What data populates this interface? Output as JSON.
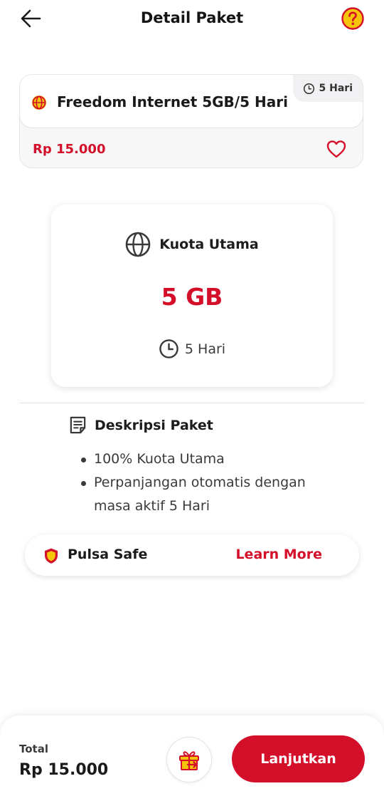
{
  "header": {
    "title": "Detail Paket",
    "back_icon": "arrow-left-icon",
    "help_icon": "question-circle-icon"
  },
  "package": {
    "name": "Freedom Internet 5GB/5 Hari",
    "duration_tag": "5 Hari",
    "price": "Rp 15.000",
    "icon": "globe-icon",
    "favorite_icon": "heart-icon"
  },
  "quota": {
    "label": "Kuota Utama",
    "amount": "5 GB",
    "duration": "5 Hari",
    "icon": "globe-icon"
  },
  "description": {
    "title": "Deskripsi Paket",
    "items": [
      "100% Kuota Utama",
      "Perpanjangan otomatis dengan masa aktif 5 Hari"
    ]
  },
  "pulsa_safe": {
    "label": "Pulsa Safe",
    "link": "Learn More",
    "icon": "shield-icon"
  },
  "footer": {
    "total_label": "Total",
    "total_amount": "Rp 15.000",
    "continue_label": "Lanjutkan",
    "gift_icon": "gift-icon"
  },
  "colors": {
    "accent": "#d40f2a",
    "help_yellow": "#f6c40a"
  }
}
